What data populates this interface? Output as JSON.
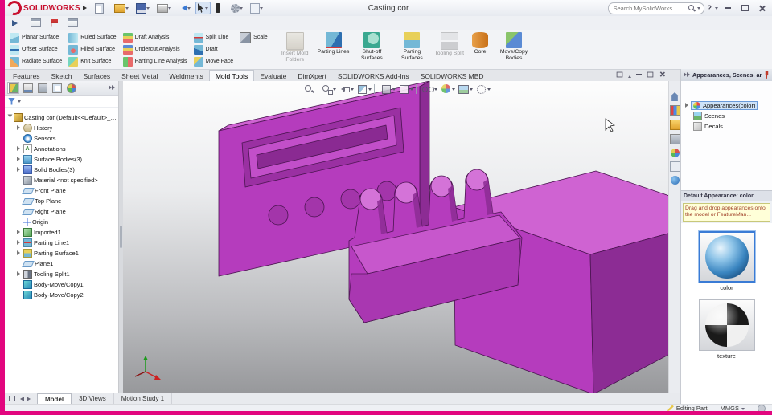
{
  "colors": {
    "accent": "#e2067e",
    "model_front": "#b53cbd",
    "model_top": "#cf63d2",
    "model_side": "#8c2c94",
    "selection": "#3a7bd5"
  },
  "window": {
    "brand": "SOLIDWORKS",
    "title": "Casting cor",
    "search_placeholder": "Search MySolidWorks",
    "help_label": "?"
  },
  "quickbar": [
    {
      "icon": "new-document"
    },
    {
      "icon": "open",
      "chev": true
    },
    {
      "icon": "save",
      "chev": true
    },
    {
      "icon": "print",
      "chev": true
    },
    {
      "icon": "undo",
      "chev": true
    },
    {
      "icon": "select-cursor",
      "chev": true,
      "cls": "pressed"
    },
    {
      "icon": "xpert"
    },
    {
      "icon": "options-gear",
      "chev": true
    },
    {
      "icon": "file-properties",
      "chev": true
    }
  ],
  "toolbar2": [
    {
      "icon": "play"
    },
    {
      "icon": "board"
    },
    {
      "icon": "flag"
    },
    {
      "icon": "board"
    }
  ],
  "ribbon": {
    "small_buttons": [
      {
        "label": "Planar Surface",
        "icon": "planar-surface"
      },
      {
        "label": "Offset Surface",
        "icon": "offset-surface"
      },
      {
        "label": "Radiate Surface",
        "icon": "radiate-surface"
      },
      {
        "label": "Ruled Surface",
        "icon": "ruled-surface"
      },
      {
        "label": "Filled Surface",
        "icon": "filled-surface"
      },
      {
        "label": "Knit Surface",
        "icon": "knit-surface"
      },
      {
        "label": "Draft Analysis",
        "icon": "draft-analysis"
      },
      {
        "label": "Undercut Analysis",
        "icon": "undercut-analysis"
      },
      {
        "label": "Parting Line Analysis",
        "icon": "parting-line-analysis"
      },
      {
        "label": "Split Line",
        "icon": "split-line"
      },
      {
        "label": "Draft",
        "icon": "draft"
      },
      {
        "label": "Move Face",
        "icon": "move-face"
      },
      {
        "label": "Scale",
        "icon": "scale"
      }
    ],
    "large_buttons": [
      {
        "label": "Insert Mold Folders",
        "icon": "insert-mold-folders",
        "cls": "disabled"
      },
      {
        "label": "Parting Lines",
        "icon": "parting-lines"
      },
      {
        "label": "Shut-off Surfaces",
        "icon": "shut-off-surfaces"
      },
      {
        "label": "Parting Surfaces",
        "icon": "parting-surfaces"
      },
      {
        "label": "Tooling Split",
        "icon": "tooling-split",
        "cls": "disabled"
      },
      {
        "label": "Core",
        "icon": "core"
      },
      {
        "label": "Move/Copy Bodies",
        "icon": "move-copy-bodies"
      }
    ]
  },
  "command_tabs": [
    {
      "label": "Features"
    },
    {
      "label": "Sketch"
    },
    {
      "label": "Surfaces"
    },
    {
      "label": "Sheet Metal"
    },
    {
      "label": "Weldments"
    },
    {
      "label": "Mold Tools",
      "cls": "active"
    },
    {
      "label": "Evaluate"
    },
    {
      "label": "DimXpert"
    },
    {
      "label": "SOLIDWORKS Add-Ins"
    },
    {
      "label": "SOLIDWORKS MBD"
    }
  ],
  "feature_tree": {
    "panel_tabs": [
      {
        "icon": "feature-manager",
        "cls": "active"
      },
      {
        "icon": "property-manager"
      },
      {
        "icon": "configuration-manager"
      },
      {
        "icon": "dimxpert-manager"
      },
      {
        "icon": "display-manager"
      }
    ],
    "items": [
      {
        "label": "Casting cor (Default<<Default>_Display S",
        "icon": "part",
        "arrow": true,
        "cls": "lvl0 expanded"
      },
      {
        "label": "History",
        "icon": "history",
        "arrow": true,
        "cls": "lvl1"
      },
      {
        "label": "Sensors",
        "icon": "sensors",
        "arrow": false,
        "cls": "lvl1"
      },
      {
        "label": "Annotations",
        "icon": "annotations",
        "arrow": true,
        "cls": "lvl1"
      },
      {
        "label": "Surface Bodies(3)",
        "icon": "folder-surface",
        "arrow": true,
        "cls": "lvl1"
      },
      {
        "label": "Solid Bodies(3)",
        "icon": "folder-solid",
        "arrow": true,
        "cls": "lvl1"
      },
      {
        "label": "Material <not specified>",
        "icon": "material",
        "arrow": false,
        "cls": "lvl1"
      },
      {
        "label": "Front Plane",
        "icon": "plane",
        "arrow": false,
        "cls": "lvl1"
      },
      {
        "label": "Top Plane",
        "icon": "plane",
        "arrow": false,
        "cls": "lvl1"
      },
      {
        "label": "Right Plane",
        "icon": "plane",
        "arrow": false,
        "cls": "lvl1"
      },
      {
        "label": "Origin",
        "icon": "origin",
        "arrow": false,
        "cls": "lvl1"
      },
      {
        "label": "Imported1",
        "icon": "imported",
        "arrow": true,
        "cls": "lvl1"
      },
      {
        "label": "Parting Line1",
        "icon": "parting-line",
        "arrow": true,
        "cls": "lvl1"
      },
      {
        "label": "Parting Surface1",
        "icon": "parting-surface",
        "arrow": true,
        "cls": "lvl1"
      },
      {
        "label": "Plane1",
        "icon": "plane",
        "arrow": false,
        "cls": "lvl1"
      },
      {
        "label": "Tooling Split1",
        "icon": "tooling-split",
        "arrow": true,
        "cls": "lvl1"
      },
      {
        "label": "Body-Move/Copy1",
        "icon": "body-move",
        "arrow": false,
        "cls": "lvl1"
      },
      {
        "label": "Body-Move/Copy2",
        "icon": "body-move",
        "arrow": false,
        "cls": "lvl1"
      }
    ]
  },
  "viewport_hud": [
    {
      "icon": "zoom-fit"
    },
    {
      "icon": "zoom-area",
      "chev": true
    },
    {
      "icon": "prev-view",
      "chev": true
    },
    {
      "icon": "section",
      "chev": true
    },
    {
      "icon": "sep"
    },
    {
      "icon": "view-cube",
      "chev": true
    },
    {
      "icon": "display-style",
      "chev": true
    },
    {
      "icon": "sep"
    },
    {
      "icon": "hide-items",
      "chev": true
    },
    {
      "icon": "edit-appearance",
      "chev": true
    },
    {
      "icon": "apply-scene",
      "chev": true
    },
    {
      "icon": "view-settings",
      "chev": true
    }
  ],
  "task_pane": {
    "header": "Appearances, Scenes, an...",
    "tree": [
      {
        "label": "Appearances(color)",
        "icon": "appearances",
        "arrow": true,
        "cls": "sel"
      },
      {
        "label": "Scenes",
        "icon": "scenes",
        "arrow": false
      },
      {
        "label": "Decals",
        "icon": "decals",
        "arrow": false
      }
    ],
    "default_label": "Default Appearance: color",
    "tooltip": "Drag and drop appearances onto the model or FeatureMan...",
    "thumbnails": [
      {
        "label": "color",
        "kind": "color",
        "cls": "sel"
      },
      {
        "label": "texture",
        "kind": "texture"
      }
    ],
    "side_tabs": [
      {
        "icon": "home"
      },
      {
        "icon": "design-library"
      },
      {
        "icon": "file-explorer"
      },
      {
        "icon": "view-palette"
      },
      {
        "icon": "appearances-tab"
      },
      {
        "icon": "custom-properties"
      },
      {
        "icon": "forum"
      }
    ]
  },
  "bottom_tabs": [
    {
      "label": "Model",
      "cls": "active"
    },
    {
      "label": "3D Views"
    },
    {
      "label": "Motion Study 1"
    }
  ],
  "status_bar": {
    "editing": "Editing Part",
    "units": "MMGS"
  }
}
